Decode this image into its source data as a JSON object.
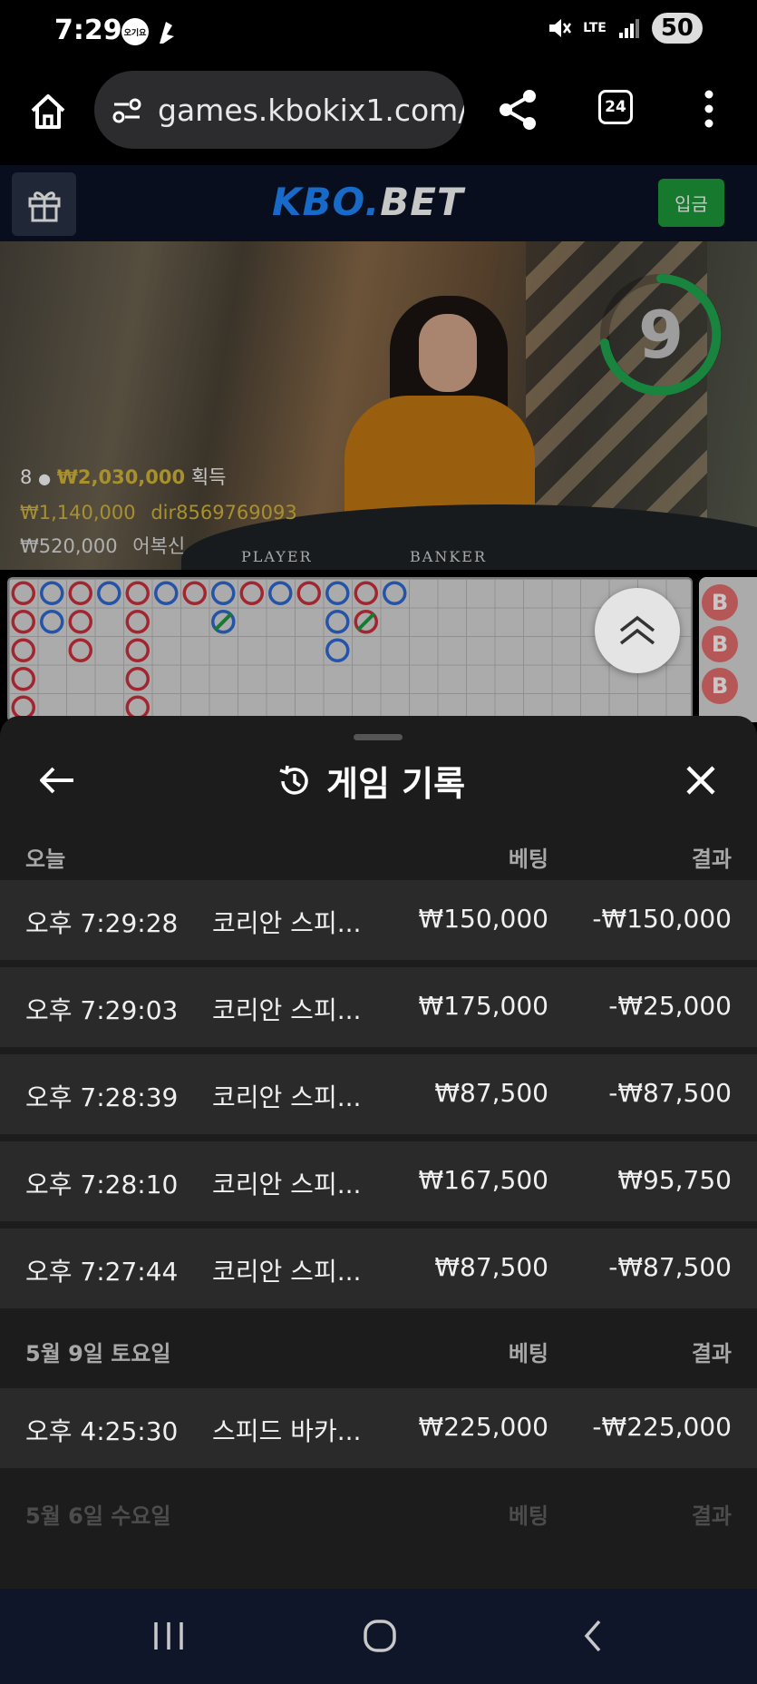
{
  "status_bar": {
    "time": "7:29",
    "badge_1": "오기요",
    "network": "LTE",
    "battery": "50"
  },
  "browser": {
    "url": "games.kbokix1.com/l",
    "tab_count": "24"
  },
  "site": {
    "logo_part1": "KBO.",
    "logo_part2": "BET",
    "deposit_label": "입금"
  },
  "video": {
    "countdown": "9",
    "players": "8",
    "total_amount": "₩2,030,000",
    "total_suffix": "획득",
    "winners": [
      {
        "amount": "₩1,140,000",
        "name": "dir8569769093"
      },
      {
        "amount": "₩520,000",
        "name": "어복신"
      }
    ],
    "table_labels": [
      "PLAYER",
      "BANKER"
    ]
  },
  "roadmap": {
    "bead_label": "B"
  },
  "sheet": {
    "title": "게임 기록",
    "sections": [
      {
        "label": "오늘",
        "bet_header": "베팅",
        "result_header": "결과",
        "rows": [
          {
            "time": "오후 7:29:28",
            "game": "코리안 스피...",
            "bet": "₩150,000",
            "result": "-₩150,000"
          },
          {
            "time": "오후 7:29:03",
            "game": "코리안 스피...",
            "bet": "₩175,000",
            "result": "-₩25,000"
          },
          {
            "time": "오후 7:28:39",
            "game": "코리안 스피...",
            "bet": "₩87,500",
            "result": "-₩87,500"
          },
          {
            "time": "오후 7:28:10",
            "game": "코리안 스피...",
            "bet": "₩167,500",
            "result": "₩95,750"
          },
          {
            "time": "오후 7:27:44",
            "game": "코리안 스피...",
            "bet": "₩87,500",
            "result": "-₩87,500"
          }
        ]
      },
      {
        "label": "5월 9일 토요일",
        "bet_header": "베팅",
        "result_header": "결과",
        "rows": [
          {
            "time": "오후 4:25:30",
            "game": "스피드 바카...",
            "bet": "₩225,000",
            "result": "-₩225,000"
          }
        ]
      },
      {
        "label": "5월 6일 수요일",
        "bet_header": "베팅",
        "result_header": "결과",
        "rows": []
      }
    ]
  },
  "colors": {
    "accent_blue": "#1e88ff",
    "deposit_green": "#1e9b3a",
    "banker_red": "#d0313d",
    "player_blue": "#2f6bd6",
    "timer_green": "#1faa50"
  }
}
